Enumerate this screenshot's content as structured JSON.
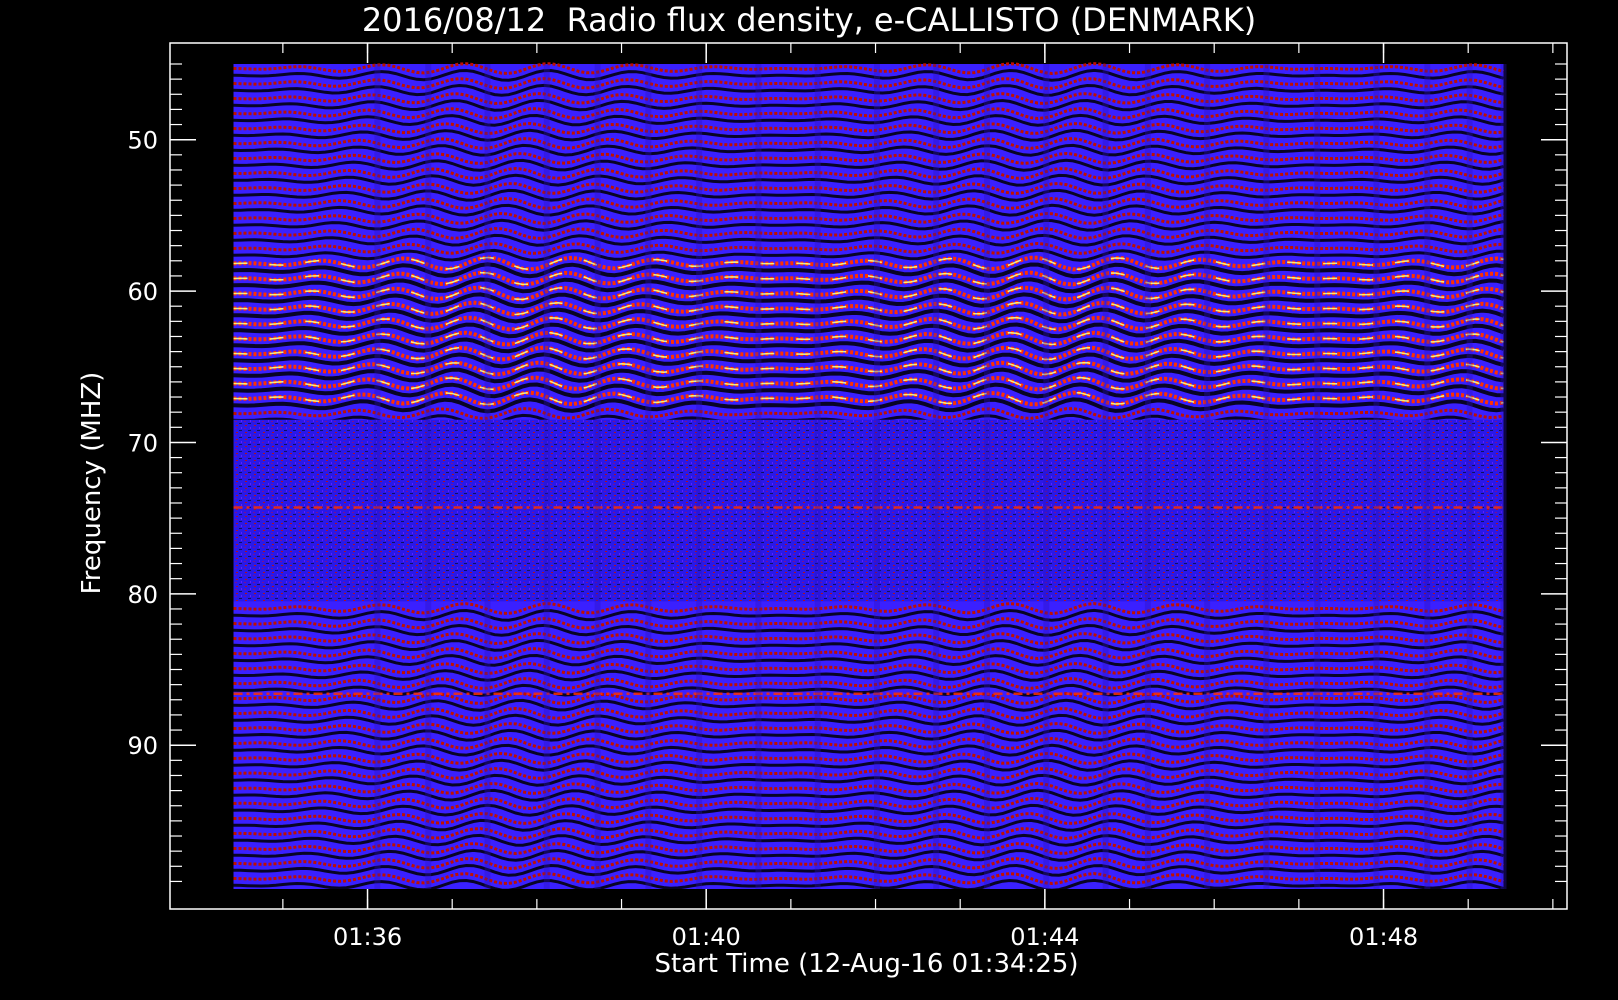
{
  "chart_data": {
    "type": "heatmap",
    "title": "2016/08/12  Radio flux density, e-CALLISTO (DENMARK)",
    "xlabel": "Start Time (12-Aug-16 01:34:25)",
    "ylabel": "Frequency (MHZ)",
    "x_unit": "minutes after 01:34:25",
    "x_range": [
      -0.75,
      15.75
    ],
    "x_data_range": [
      0.0,
      15.0
    ],
    "x_ticks": [
      {
        "value": 1.583,
        "label": "01:36"
      },
      {
        "value": 5.583,
        "label": "01:40"
      },
      {
        "value": 9.583,
        "label": "01:44"
      },
      {
        "value": 13.583,
        "label": "01:48"
      }
    ],
    "y_range": [
      45.0,
      99.5
    ],
    "y_data_range": [
      45.0,
      99.5
    ],
    "y_inverted": true,
    "y_ticks": [
      50,
      60,
      70,
      80,
      90
    ],
    "colormap": [
      "#000000",
      "#2a10c0",
      "#3a20ff",
      "#c01000",
      "#ff3000",
      "#ffff80"
    ],
    "strong_band_mhz": [
      58,
      68
    ],
    "noisy_band_mhz": [
      68.5,
      80.5
    ],
    "bright_rows_mhz": [
      74.3,
      86.6
    ],
    "columns_sample_min": [
      1.7,
      2.3,
      3.0,
      3.7,
      4.3,
      4.9,
      5.5,
      6.2,
      6.9,
      7.6,
      8.3,
      8.9,
      9.6,
      10.3,
      10.8,
      11.5,
      12.2,
      12.8,
      13.5,
      14.1,
      14.6,
      15.0
    ]
  }
}
